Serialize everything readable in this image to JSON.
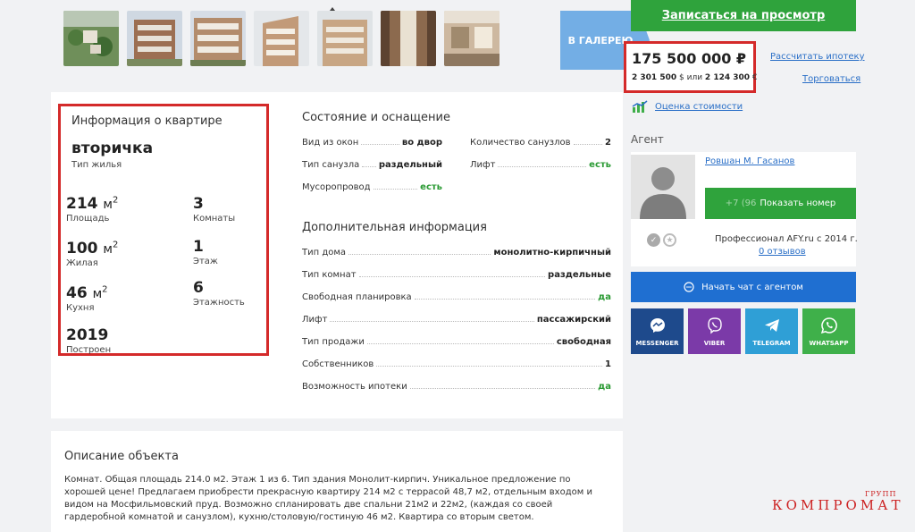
{
  "gallery": {
    "button_label": "В ГАЛЕРЕЮ",
    "thumbnails": [
      "aerial-view",
      "building-facade-1",
      "building-facade-2",
      "building-facade-3",
      "building-facade-4",
      "interior-atrium",
      "interior-room"
    ]
  },
  "apartment": {
    "title": "Информация о квартире",
    "type_value": "вторичка",
    "type_label": "Тип жилья",
    "area_value": "214",
    "area_label": "Площадь",
    "rooms_value": "3",
    "rooms_label": "Комнаты",
    "living_value": "100",
    "living_label": "Жилая",
    "floor_value": "1",
    "floor_label": "Этаж",
    "kitchen_value": "46",
    "kitchen_label": "Кухня",
    "floors_value": "6",
    "floors_label": "Этажность",
    "built_value": "2019",
    "built_label": "Построен",
    "unit": "м",
    "unit_sup": "2"
  },
  "condition": {
    "title": "Состояние и оснащение",
    "rows": [
      {
        "k": "Вид из окон",
        "v": "во двор"
      },
      {
        "k": "Тип санузла",
        "v": "раздельный"
      },
      {
        "k": "Мусоропровод",
        "v": "есть"
      },
      {
        "k": "Количество санузлов",
        "v": "2"
      },
      {
        "k": "Лифт",
        "v": "есть"
      }
    ]
  },
  "extra": {
    "title": "Дополнительная информация",
    "rows": [
      {
        "k": "Тип дома",
        "v": "монолитно-кирпичный"
      },
      {
        "k": "Тип комнат",
        "v": "раздельные"
      },
      {
        "k": "Свободная планировка",
        "v": "да"
      },
      {
        "k": "Лифт",
        "v": "пассажирский"
      },
      {
        "k": "Тип продажи",
        "v": "свободная"
      },
      {
        "k": "Собственников",
        "v": "1"
      },
      {
        "k": "Возможность ипотеки",
        "v": "да"
      }
    ]
  },
  "description": {
    "title": "Описание объекта",
    "text": "Комнат. Общая площадь 214.0 м2. Этаж 1 из 6. Тип здания Монолит-кирпич. Уникальное предложение по хорошей цене! Предлагаем приобрести прекрасную квартиру 214 м2 с террасой 48,7 м2, отдельным входом и видом на Мосфильмовский пруд. Возможно спланировать две спальни 21м2 и 22м2, (каждая со своей гардеробной комнатой и санузлом), кухню/столовую/гостиную 46 м2. Квартира со вторым светом."
  },
  "sidebar": {
    "view_button": "Записаться на просмотр",
    "price": "175 500 000 ₽",
    "price_usd": "2 301 500",
    "price_usd_sym": "$",
    "price_or": "или",
    "price_eur": "2 124 300",
    "price_eur_sym": "€",
    "mortgage_link": "Рассчитать ипотеку",
    "bargain_link": "Торговаться",
    "estimate_link": "Оценка стоимости",
    "agent_label": "Агент",
    "agent_name": "Ровшан М. Гасанов",
    "phone_prefix": "+7 (96",
    "phone_button": "Показать номер",
    "pro_text": "Профессионал AFY.ru с 2014 г.",
    "reviews_link": "0 отзывов",
    "chat_button": "Начать чат с агентом",
    "messengers": [
      {
        "label": "MESSENGER",
        "color": "#1e4a8c"
      },
      {
        "label": "VIBER",
        "color": "#7b3aa8"
      },
      {
        "label": "TELEGRAM",
        "color": "#2f9fd6"
      },
      {
        "label": "WHATSAPP",
        "color": "#3fb04a"
      }
    ]
  },
  "watermark": {
    "text": "КОМПРОМАТ",
    "sup": "ГРУПП"
  }
}
